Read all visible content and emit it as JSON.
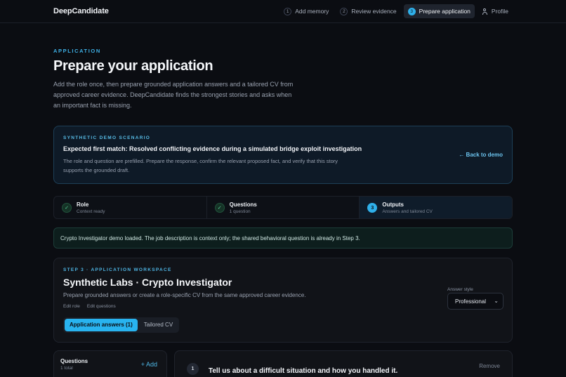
{
  "app": {
    "brand": "DeepCandidate"
  },
  "nav": {
    "items": [
      {
        "num": "1",
        "label": "Add memory"
      },
      {
        "num": "2",
        "label": "Review evidence"
      },
      {
        "num": "3",
        "label": "Prepare application"
      },
      {
        "label": "Profile"
      }
    ]
  },
  "hero": {
    "eyebrow": "APPLICATION",
    "title": "Prepare your application",
    "intro": "Add the role once, then prepare grounded application answers and a tailored CV from approved career evidence. DeepCandidate finds the strongest stories and asks when an important fact is missing."
  },
  "scenario": {
    "tag": "SYNTHETIC DEMO SCENARIO",
    "heading": "Expected first match: Resolved conflicting evidence during a simulated bridge exploit investigation",
    "body": "The role and question are prefilled. Prepare the response, confirm the relevant proposed fact, and verify that this story supports the grounded draft.",
    "back_label": "← Back to demo"
  },
  "stepper": {
    "steps": [
      {
        "dot": "✓",
        "label": "Role",
        "sub": "Context ready"
      },
      {
        "dot": "✓",
        "label": "Questions",
        "sub": "1 question"
      },
      {
        "dot": "3",
        "label": "Outputs",
        "sub": "Answers and tailored CV"
      }
    ]
  },
  "alert": {
    "text": "Crypto Investigator demo loaded. The job description is context only; the shared behavioral question is already in Step 3."
  },
  "workspace": {
    "tag": "STEP 3 · APPLICATION WORKSPACE",
    "title": "Synthetic Labs · Crypto Investigator",
    "description": "Prepare grounded answers or create a role-specific CV from the same approved career evidence.",
    "edit_role": "Edit role",
    "edit_questions": "Edit questions",
    "tabs": [
      "Application answers (1)",
      "Tailored CV"
    ],
    "answer_style_label": "Answer style",
    "answer_style_value": "Professional"
  },
  "questions_panel": {
    "heading": "Questions",
    "count": "1 total",
    "add_label": "+ Add"
  },
  "answer_panel": {
    "number": "1",
    "question": "Tell us about a difficult situation and how you handled it.",
    "remove_label": "Remove"
  }
}
